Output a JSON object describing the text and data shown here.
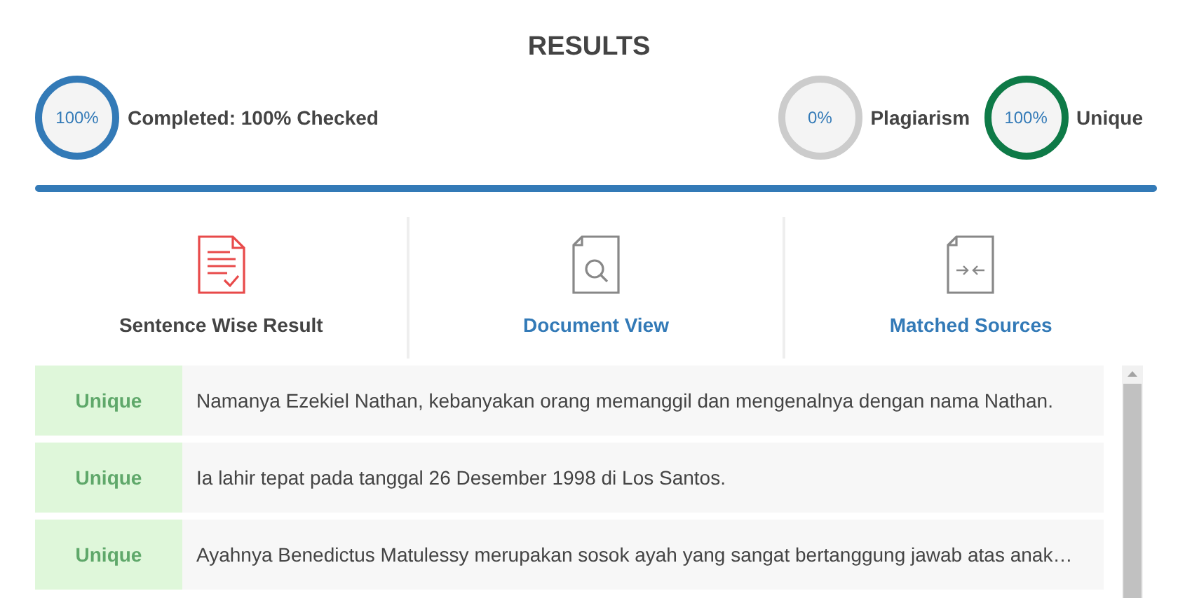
{
  "title": "RESULTS",
  "stats": [
    {
      "value": "100%",
      "label": "Completed: 100% Checked",
      "color": "#337ab7"
    },
    {
      "value": "0%",
      "label": "Plagiarism",
      "color": "#cccccc"
    },
    {
      "value": "100%",
      "label": "Unique",
      "color": "#0e7a47"
    }
  ],
  "tabs": [
    {
      "label": "Sentence Wise Result",
      "kind": "sentences",
      "selected": true
    },
    {
      "label": "Document View",
      "kind": "document",
      "selected": false
    },
    {
      "label": "Matched Sources",
      "kind": "sources",
      "selected": false
    }
  ],
  "rows": [
    {
      "status": "Unique",
      "text": "Namanya Ezekiel Nathan, kebanyakan orang memanggil dan mengenalnya dengan nama Nathan."
    },
    {
      "status": "Unique",
      "text": "Ia lahir tepat pada tanggal 26 Desember 1998 di Los Santos."
    },
    {
      "status": "Unique",
      "text": "Ayahnya Benedictus Matulessy merupakan sosok ayah yang sangat bertanggung jawab atas anak…"
    }
  ]
}
